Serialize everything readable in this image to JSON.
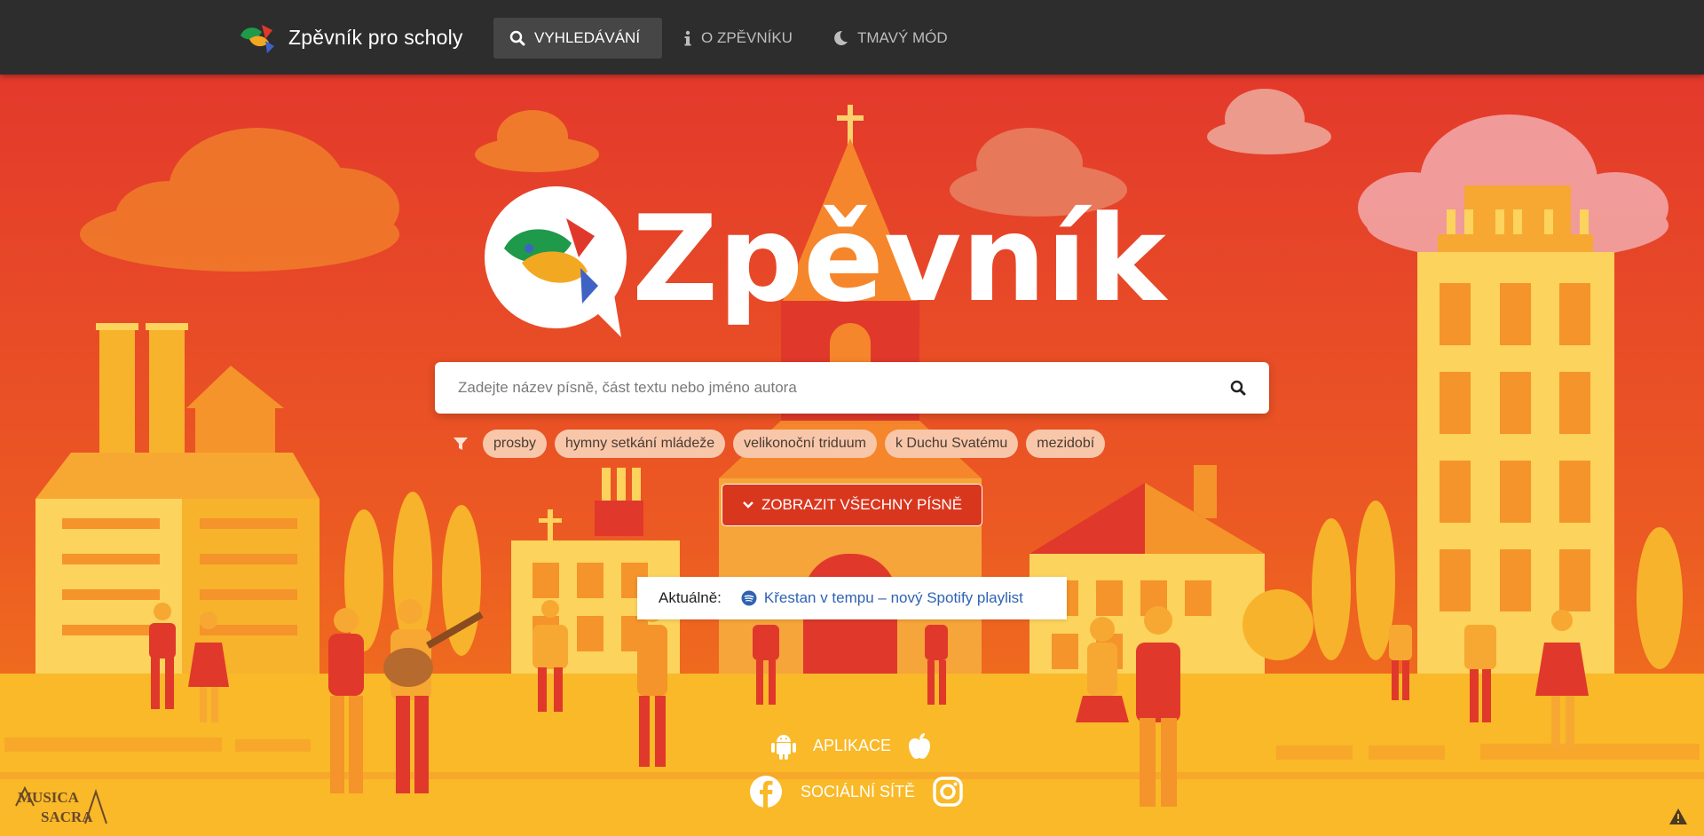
{
  "navbar": {
    "brand": "Zpěvník pro scholy",
    "items": [
      {
        "label": "VYHLEDÁVÁNÍ",
        "icon": "search-icon",
        "active": true
      },
      {
        "label": "O ZPĚVNÍKU",
        "icon": "info-icon",
        "active": false
      },
      {
        "label": "TMAVÝ MÓD",
        "icon": "moon-icon",
        "active": false
      }
    ]
  },
  "hero": {
    "logo_text": "Zpěvník",
    "search": {
      "placeholder": "Zadejte název písně, část textu nebo jméno autora",
      "value": ""
    },
    "filters": [
      "prosby",
      "hymny setkání mládeže",
      "velikonoční triduum",
      "k Duchu Svatému",
      "mezidobí"
    ],
    "show_all_label": "ZOBRAZIT VŠECHNY PÍSNĚ",
    "news": {
      "label": "Aktuálně:",
      "link": "Křestan v tempu – nový Spotify playlist"
    }
  },
  "footer": {
    "apps_label": "APLIKACE",
    "social_label": "SOCIÁLNÍ SÍTĚ",
    "logo_text": "MUSICA SACRA"
  },
  "colors": {
    "navbar": "#2d2d2d",
    "sky": "#e8452c",
    "accent": "#d9361e",
    "tag": "#f8c7aa",
    "link": "#2f63b3"
  }
}
